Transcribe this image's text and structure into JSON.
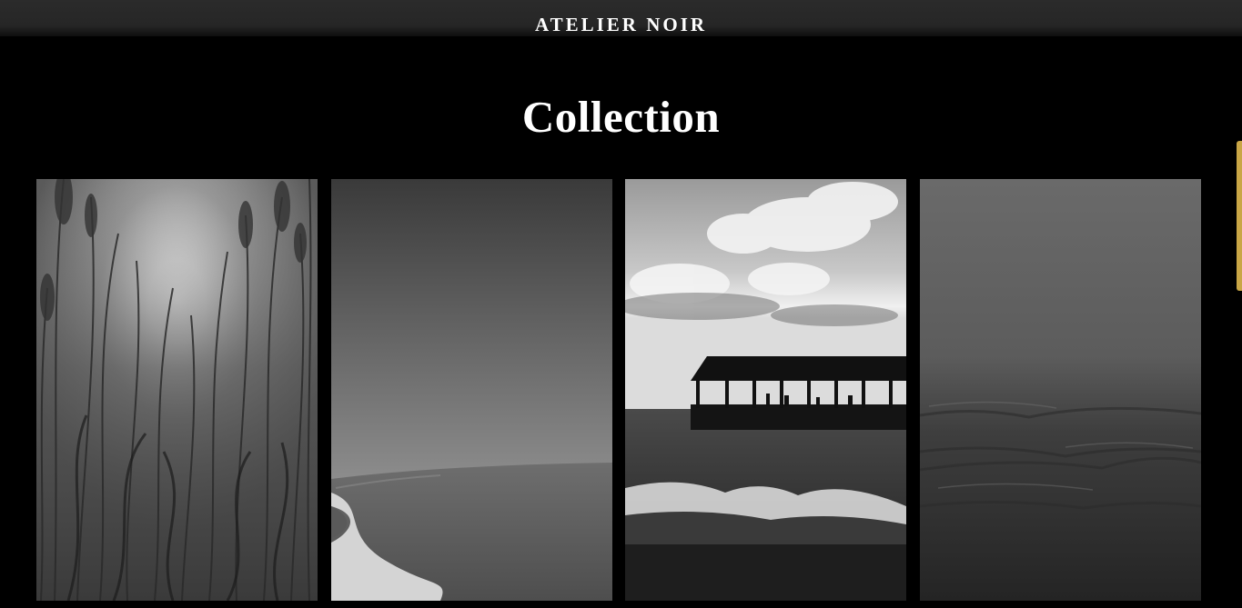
{
  "header": {
    "brand": "ATELIER NOIR"
  },
  "page": {
    "title": "Collection"
  },
  "gallery": {
    "items": [
      {
        "subject": "reeds-sunlight"
      },
      {
        "subject": "country-path"
      },
      {
        "subject": "pier-waves"
      },
      {
        "subject": "misty-sea"
      }
    ]
  },
  "colors": {
    "background": "#000000",
    "header": "#262626",
    "text": "#ffffff",
    "accent": "#c9a646"
  }
}
